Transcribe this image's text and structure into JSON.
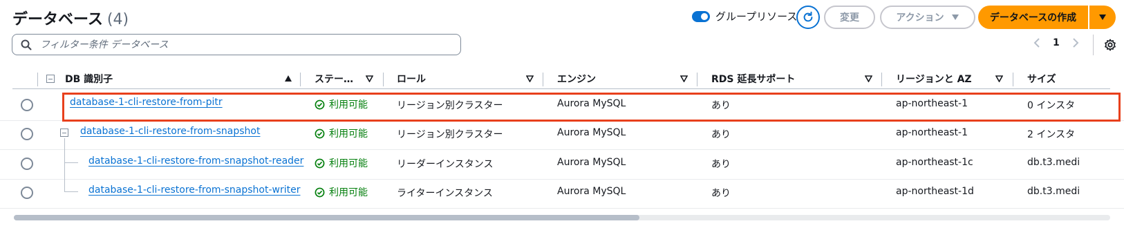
{
  "header": {
    "title": "データベース",
    "count": "(4)",
    "group_toggle_label": "グループリソース",
    "modify_label": "変更",
    "actions_label": "アクション",
    "create_label": "データベースの作成"
  },
  "filter": {
    "placeholder": "フィルター条件 データベース"
  },
  "pagination": {
    "current_page": "1"
  },
  "columns": {
    "db_id": "DB 識別子",
    "status": "ステー…",
    "role": "ロール",
    "engine": "エンジン",
    "rds_ext": "RDS 延長サポート",
    "region": "リージョンと AZ",
    "size": "サイズ"
  },
  "rows": [
    {
      "id": "database-1-cli-restore-from-pitr",
      "status": "利用可能",
      "role": "リージョン別クラスター",
      "engine": "Aurora MySQL",
      "rds_ext": "あり",
      "region": "ap-northeast-1",
      "size": "0 インスタ"
    },
    {
      "id": "database-1-cli-restore-from-snapshot",
      "status": "利用可能",
      "role": "リージョン別クラスター",
      "engine": "Aurora MySQL",
      "rds_ext": "あり",
      "region": "ap-northeast-1",
      "size": "2 インスタ"
    },
    {
      "id": "database-1-cli-restore-from-snapshot-reader",
      "status": "利用可能",
      "role": "リーダーインスタンス",
      "engine": "Aurora MySQL",
      "rds_ext": "あり",
      "region": "ap-northeast-1c",
      "size": "db.t3.medi"
    },
    {
      "id": "database-1-cli-restore-from-snapshot-writer",
      "status": "利用可能",
      "role": "ライターインスタンス",
      "engine": "Aurora MySQL",
      "rds_ext": "あり",
      "region": "ap-northeast-1d",
      "size": "db.t3.medi"
    }
  ],
  "colors": {
    "accent": "#0972d3",
    "primary": "#ff9900",
    "success": "#037f0c",
    "highlight": "#e8401c"
  }
}
